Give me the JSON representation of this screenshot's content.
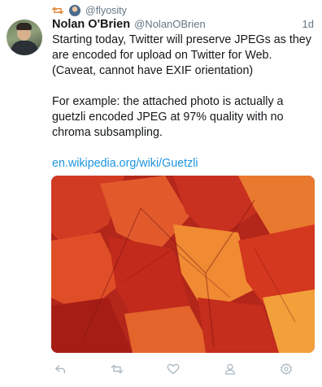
{
  "retweet": {
    "handle": "@flyosity"
  },
  "tweet": {
    "author_name": "Nolan O'Brien",
    "author_handle": "@NolanOBrien",
    "time": "1d",
    "paragraph1": "Starting today, Twitter will preserve JPEGs as they are encoded for upload on Twitter for Web. (Caveat, cannot have EXIF orientation)",
    "paragraph2": "For example: the attached photo is actually a guetzli encoded JPEG at 97% quality with no chroma subsampling.",
    "link": "en.wikipedia.org/wiki/Guetzli"
  },
  "colors": {
    "link": "#1b95e0",
    "retweet": "#e0832f",
    "muted": "#657786",
    "icon": "#aab8c2"
  },
  "icons": [
    "reply-icon",
    "retweet-icon",
    "like-icon",
    "follow-icon",
    "settings-icon"
  ]
}
